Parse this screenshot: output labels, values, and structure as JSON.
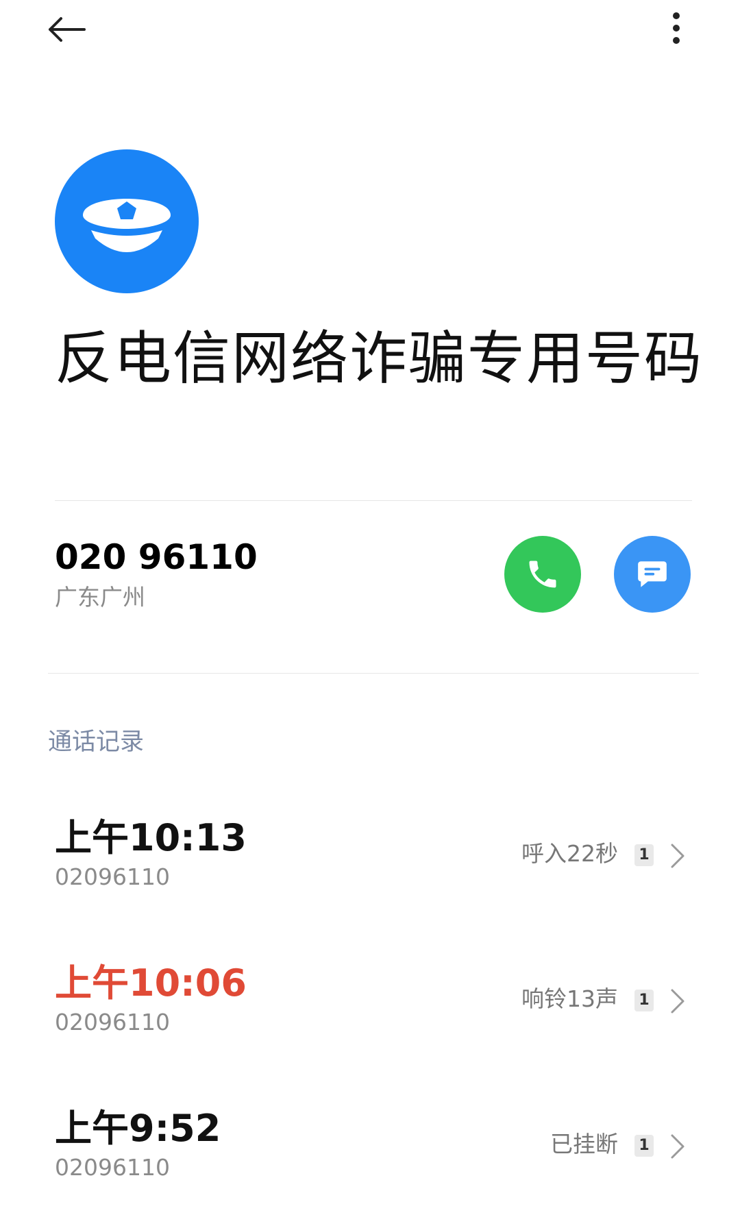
{
  "header": {
    "back_icon": "arrow-left-icon",
    "more_icon": "more-vertical-icon"
  },
  "contact": {
    "avatar_icon": "police-cap-icon",
    "avatar_color": "#1a84f6",
    "name": "反电信网络诈骗专用号码"
  },
  "phone": {
    "number": "020 96110",
    "location": "广东广州",
    "call_icon": "phone-icon",
    "call_color": "#33c75a",
    "message_icon": "message-icon",
    "message_color": "#3a95f5"
  },
  "call_log": {
    "title": "通话记录",
    "items": [
      {
        "time": "上午10:13",
        "number": "02096110",
        "status": "呼入22秒",
        "count": "1",
        "missed": false
      },
      {
        "time": "上午10:06",
        "number": "02096110",
        "status": "响铃13声",
        "count": "1",
        "missed": true
      },
      {
        "time": "上午9:52",
        "number": "02096110",
        "status": "已挂断",
        "count": "1",
        "missed": false
      }
    ],
    "missed_color": "#e04a36"
  }
}
